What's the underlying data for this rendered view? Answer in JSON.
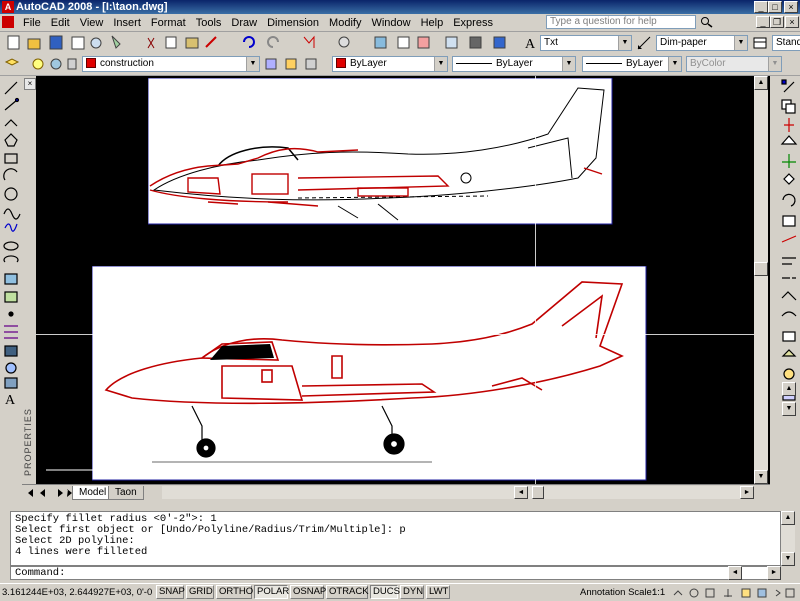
{
  "title_bar": {
    "title": "AutoCAD 2008 - [I:\\taon.dwg]"
  },
  "menu": [
    "File",
    "Edit",
    "View",
    "Insert",
    "Format",
    "Tools",
    "Draw",
    "Dimension",
    "Modify",
    "Window",
    "Help",
    "Express"
  ],
  "help_search": {
    "placeholder": "Type a question for help"
  },
  "styles_toolbar": {
    "text_style": "Txt",
    "dim_style": "Dim-paper",
    "table_style": "Standa"
  },
  "layers_toolbar": {
    "layer": "construction",
    "color": "ByLayer",
    "linetype": "ByLayer",
    "lineweight": "ByLayer",
    "plot_style": "ByColor",
    "layer_color": "#e00000"
  },
  "layout_tabs": [
    "Model",
    "Taon"
  ],
  "properties_palette": {
    "label": "PROPERTIES"
  },
  "command_history": [
    "Specify fillet radius <0'-2\">: 1",
    "Select first object or [Undo/Polyline/Radius/Trim/Multiple]: p",
    "Select 2D polyline:",
    "4 lines were filleted"
  ],
  "command_prompt": "Command:",
  "status_bar": {
    "coordinates": "3.161244E+03, 2.644927E+03, 0'-0\"",
    "toggles": [
      {
        "label": "SNAP",
        "on": false
      },
      {
        "label": "GRID",
        "on": false
      },
      {
        "label": "ORTHO",
        "on": false
      },
      {
        "label": "POLAR",
        "on": true
      },
      {
        "label": "OSNAP",
        "on": false
      },
      {
        "label": "OTRACK",
        "on": false
      },
      {
        "label": "DUCS",
        "on": true
      },
      {
        "label": "DYN",
        "on": false
      },
      {
        "label": "LWT",
        "on": false
      }
    ],
    "annotation_scale_label": "Annotation Scale:",
    "annotation_scale": "1:1"
  },
  "colors": {
    "accent_red": "#c00000",
    "canvas": "#000000",
    "titlebar": "#0a246a"
  }
}
